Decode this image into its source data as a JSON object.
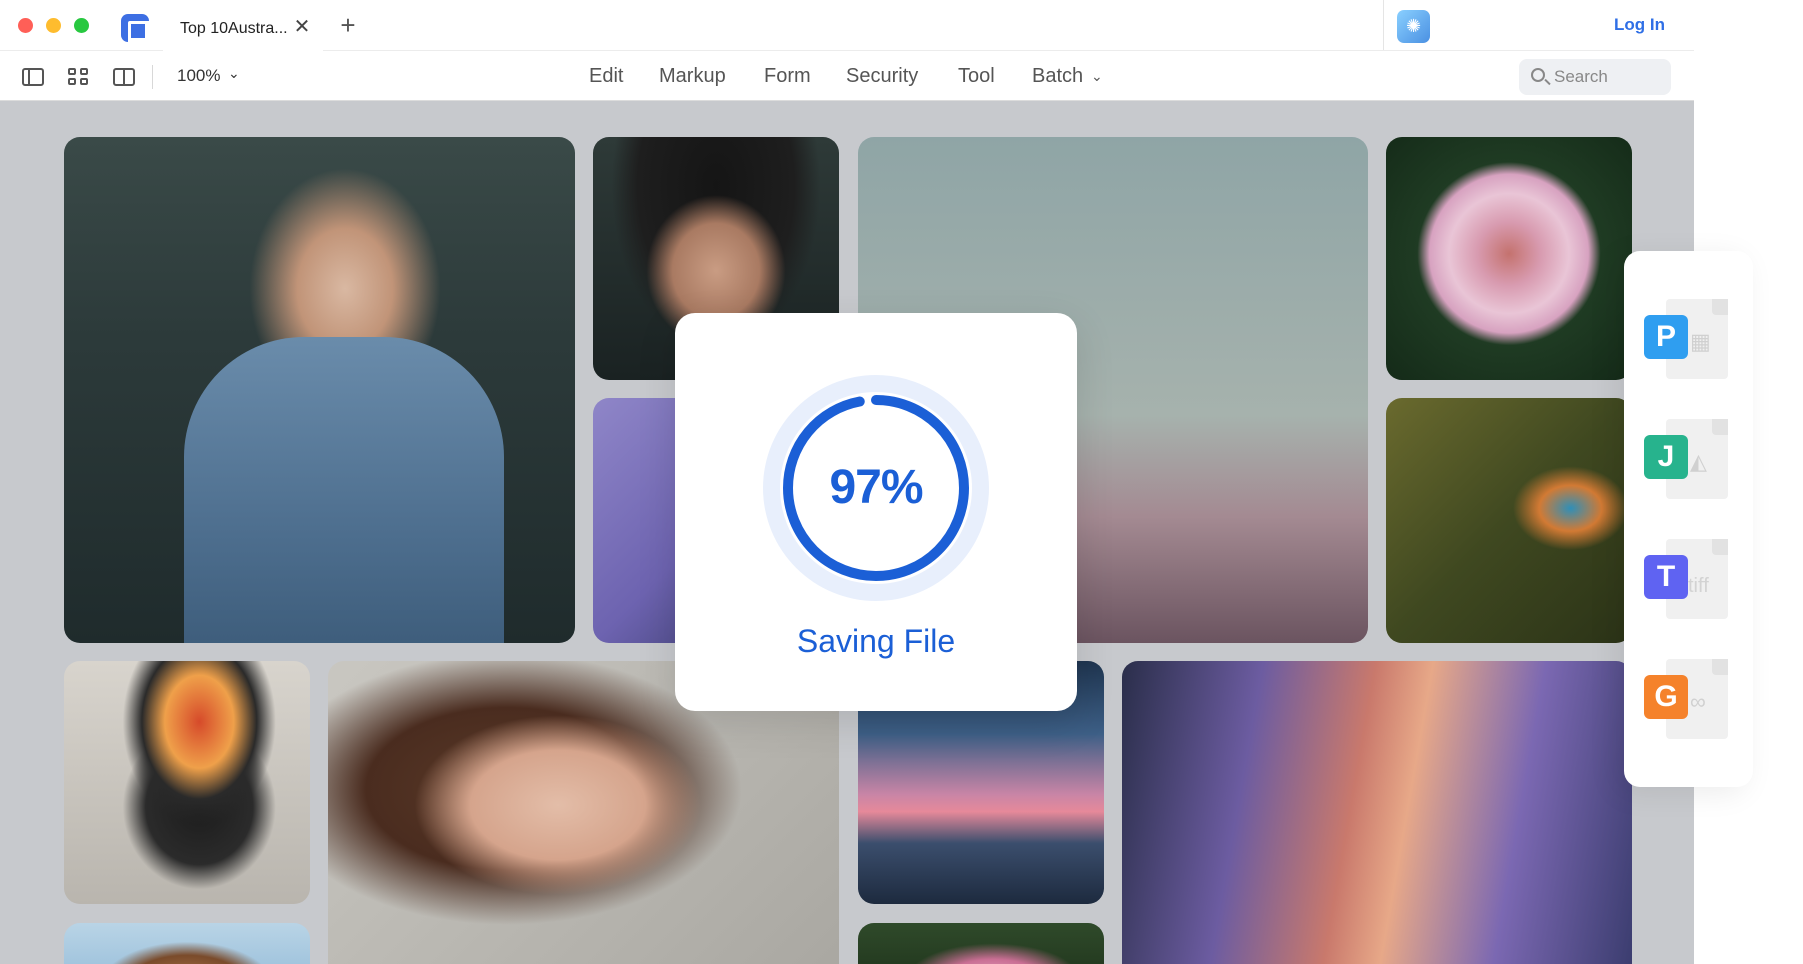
{
  "tab": {
    "title": "Top 10Austra...",
    "close_glyph": "✕",
    "add_glyph": "+"
  },
  "header": {
    "login_label": "Log In"
  },
  "toolbar": {
    "zoom": "100%",
    "chevron": "⌄",
    "menu": [
      "Edit",
      "Markup",
      "Form",
      "Security",
      "Tool",
      "Batch"
    ]
  },
  "search": {
    "placeholder": "Search"
  },
  "saving": {
    "percent_label": "97%",
    "progress": 0.97,
    "label": "Saving File"
  },
  "formats": [
    {
      "letter": "P",
      "mark": "▦",
      "color": "#2f9ef0"
    },
    {
      "letter": "J",
      "mark": "◭",
      "color": "#27b38d"
    },
    {
      "letter": "T",
      "mark": "tiff",
      "color": "#5f63f2"
    },
    {
      "letter": "G",
      "mark": "∞",
      "color": "#f5822b"
    }
  ],
  "colors": {
    "accent": "#1b5fd6",
    "login": "#2f6fe6",
    "ring_track": "#e8effc"
  }
}
